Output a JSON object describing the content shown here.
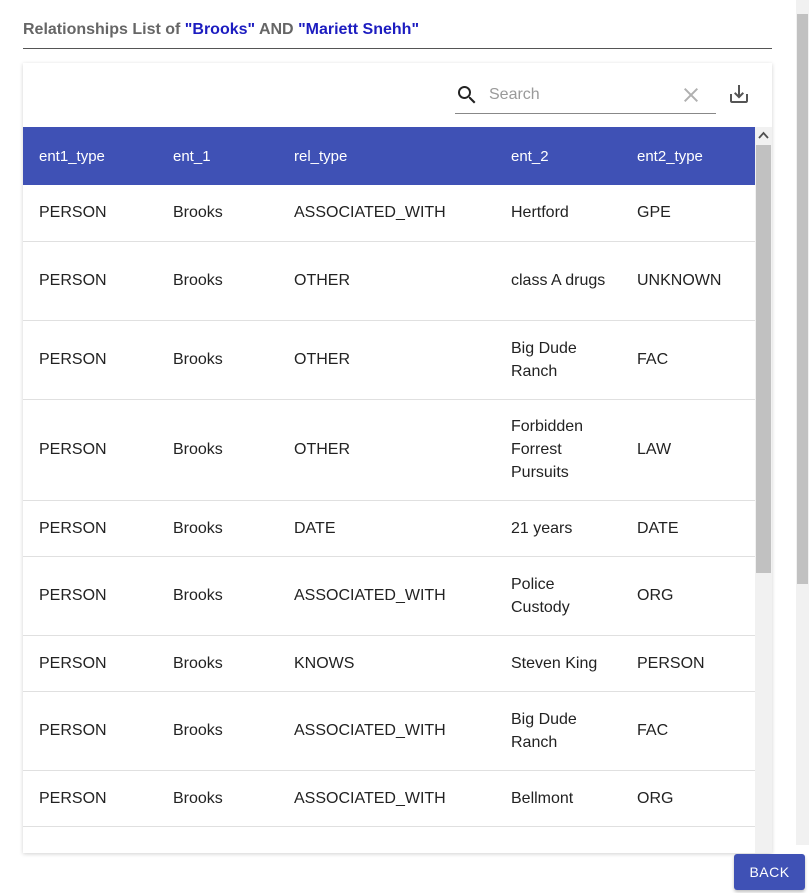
{
  "title": {
    "prefix": "Relationships List of ",
    "entity1": "\"Brooks\"",
    "joiner": " AND ",
    "entity2": "\"Mariett Snehh\""
  },
  "search": {
    "placeholder": "Search",
    "value": ""
  },
  "icons": {
    "search": "search-icon",
    "clear": "close-icon",
    "download": "download-icon"
  },
  "colors": {
    "header_bg": "#3f51b5",
    "title_highlight": "#1c1cc0"
  },
  "table": {
    "columns": [
      "ent1_type",
      "ent_1",
      "rel_type",
      "ent_2",
      "ent2_type"
    ],
    "rows": [
      [
        "PERSON",
        "Brooks",
        "ASSOCIATED_WITH",
        "Hertford",
        "GPE"
      ],
      [
        "PERSON",
        "Brooks",
        "OTHER",
        "class A drugs",
        "UNKNOWN"
      ],
      [
        "PERSON",
        "Brooks",
        "OTHER",
        "Big Dude Ranch",
        "FAC"
      ],
      [
        "PERSON",
        "Brooks",
        "OTHER",
        "Forbidden Forrest Pursuits",
        "LAW"
      ],
      [
        "PERSON",
        "Brooks",
        "DATE",
        "21 years",
        "DATE"
      ],
      [
        "PERSON",
        "Brooks",
        "ASSOCIATED_WITH",
        "Police Custody",
        "ORG"
      ],
      [
        "PERSON",
        "Brooks",
        "KNOWS",
        "Steven King",
        "PERSON"
      ],
      [
        "PERSON",
        "Brooks",
        "ASSOCIATED_WITH",
        "Big Dude Ranch",
        "FAC"
      ],
      [
        "PERSON",
        "Brooks",
        "ASSOCIATED_WITH",
        "Bellmont",
        "ORG"
      ],
      [
        "",
        "",
        "",
        "",
        ""
      ]
    ]
  },
  "back_label": "BACK"
}
